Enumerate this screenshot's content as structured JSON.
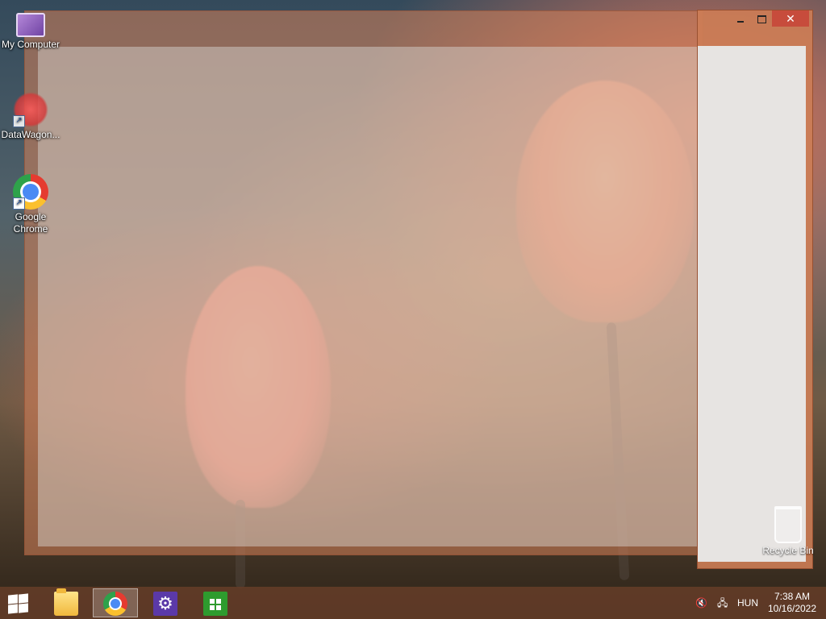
{
  "desktop": {
    "icons": [
      {
        "label": "My Computer"
      },
      {
        "label": "DataWagon..."
      },
      {
        "label": "Google Chrome"
      }
    ],
    "recycle_bin": {
      "label": "Recycle Bin"
    }
  },
  "window": {
    "controls": {
      "minimize": "–",
      "maximize": "",
      "close": "✕"
    }
  },
  "taskbar": {
    "apps": [
      {
        "name": "File Explorer",
        "active": false
      },
      {
        "name": "Google Chrome",
        "active": true
      },
      {
        "name": "Settings",
        "active": false
      },
      {
        "name": "Store",
        "active": false
      }
    ],
    "tray": {
      "language": "HUN",
      "time": "7:38 AM",
      "date": "10/16/2022"
    }
  }
}
